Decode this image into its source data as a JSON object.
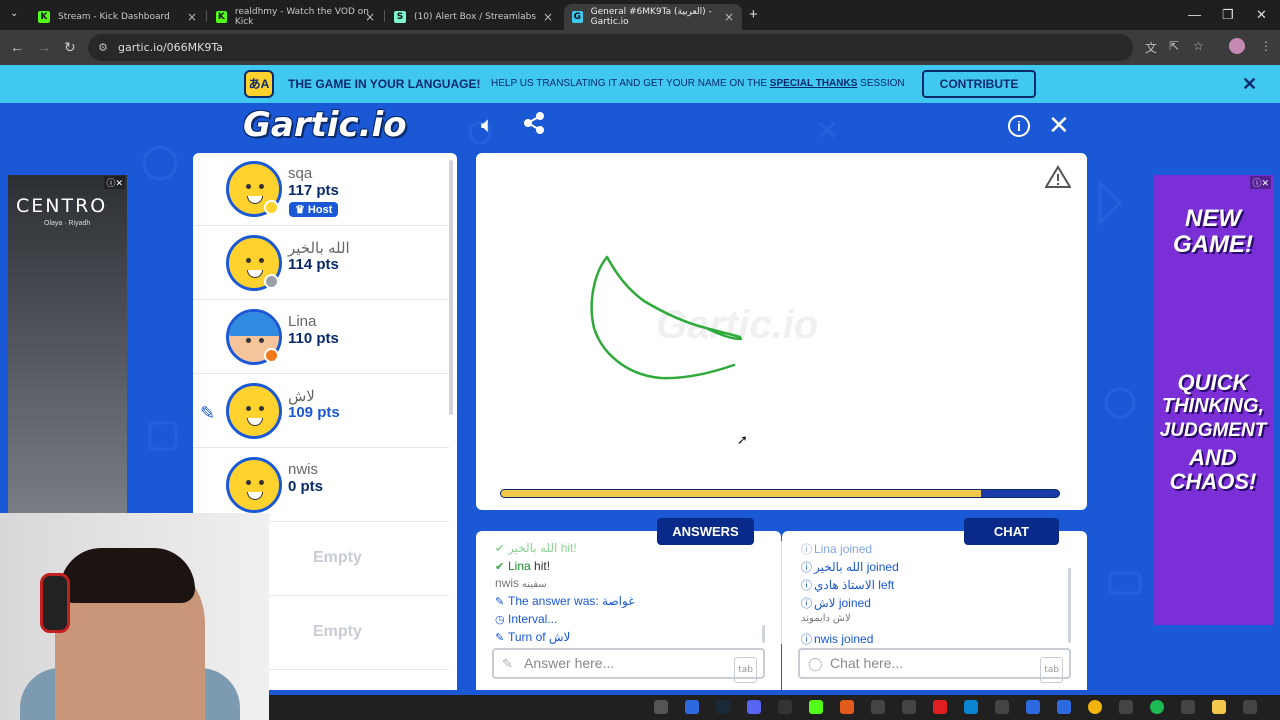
{
  "browser": {
    "tabs": [
      {
        "title": "Stream - Kick Dashboard",
        "favicon": "K"
      },
      {
        "title": "realdhmy - Watch the VOD on Kick",
        "favicon": "K"
      },
      {
        "title": "(10) Alert Box / Streamlabs",
        "favicon": "S"
      },
      {
        "title": "General #6MK9Ta (العربية) - Gartic.io",
        "favicon": "G"
      }
    ],
    "url": "gartic.io/066MK9Ta"
  },
  "banner": {
    "icon_text": "あA",
    "title": "THE GAME IN YOUR LANGUAGE!",
    "sub_before": "HELP US TRANSLATING IT AND GET YOUR NAME ON THE ",
    "sub_link": "SPECIAL THANKS",
    "sub_after": " SESSION",
    "contribute": "CONTRIBUTE"
  },
  "game": {
    "logo": "Gartic.io",
    "players": [
      {
        "name": "sqa",
        "points": "117 pts",
        "badge": "Host",
        "dot": "#ffd22e"
      },
      {
        "name": "الله بالخير",
        "points": "114 pts",
        "dot": "#9aa0a8"
      },
      {
        "name": "Lina",
        "points": "110 pts",
        "dot": "#f07a1a"
      },
      {
        "name": "لاش",
        "points": "109 pts",
        "dot": ""
      },
      {
        "name": "nwis",
        "points": "0 pts",
        "dot": ""
      }
    ],
    "empty_slots": [
      "Empty",
      "Empty"
    ],
    "watermark": "Gartic.io",
    "timer_progress": 0.86,
    "answers_tab": "ANSWERS",
    "chat_tab": "CHAT",
    "answers": [
      {
        "icon": "check",
        "user": "الله بالخير",
        "text": " hit!"
      },
      {
        "icon": "check",
        "user": "Lina",
        "text": " hit!"
      },
      {
        "icon": "",
        "user": "nwis",
        "text": " سفينه"
      },
      {
        "icon": "pencil",
        "user": "",
        "text": "The answer was: غواصة"
      },
      {
        "icon": "clock",
        "user": "",
        "text": "Interval..."
      },
      {
        "icon": "pencil",
        "user": "",
        "text": "Turn of لاش"
      }
    ],
    "chat": [
      {
        "user": "Lina",
        "text": " joined"
      },
      {
        "user": "الله بالخير",
        "text": " joined"
      },
      {
        "user": "الاستاذ هادي",
        "text": " left"
      },
      {
        "user": "لاش",
        "text": " joined"
      },
      {
        "user": "",
        "text": "لاش دايموند"
      },
      {
        "user": "nwis",
        "text": " joined"
      }
    ],
    "answer_placeholder": "Answer here...",
    "chat_placeholder": "Chat here...",
    "tab_key": "tab"
  },
  "ads": {
    "left_brand": "CENTRO",
    "left_sub": "Olaya · Riyadh",
    "right_lines": [
      "NEW",
      "GAME!",
      "QUICK",
      "THINKING,",
      "JUDGMENT",
      "AND",
      "CHAOS!"
    ]
  },
  "colors": {
    "background": "#1a58d6",
    "banner": "#40c8f0",
    "navy": "#0a2a6a",
    "stroke": "#2eaa3a"
  }
}
